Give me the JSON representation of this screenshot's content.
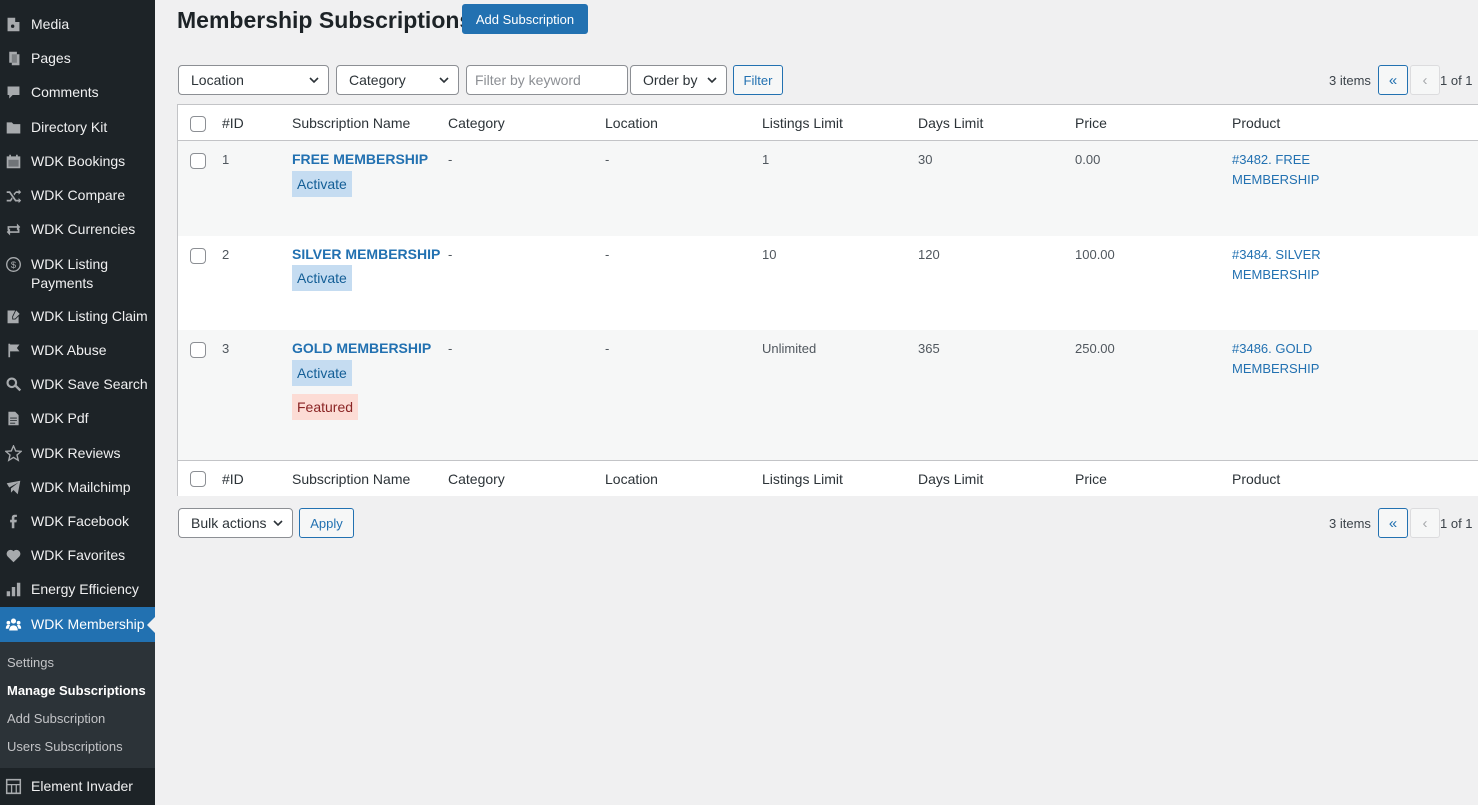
{
  "sidebar": {
    "items": [
      {
        "label": "Media",
        "icon": "media-icon"
      },
      {
        "label": "Pages",
        "icon": "pages-icon"
      },
      {
        "label": "Comments",
        "icon": "comments-icon"
      },
      {
        "label": "Directory Kit",
        "icon": "folder-icon"
      },
      {
        "label": "WDK Bookings",
        "icon": "calendar-icon"
      },
      {
        "label": "WDK Compare",
        "icon": "shuffle-icon"
      },
      {
        "label": "WDK Currencies",
        "icon": "exchange-icon"
      },
      {
        "label": "WDK Listing Payments",
        "icon": "dollar-icon"
      },
      {
        "label": "WDK Listing Claim",
        "icon": "edit-page-icon"
      },
      {
        "label": "WDK Abuse",
        "icon": "flag-icon"
      },
      {
        "label": "WDK Save Search",
        "icon": "search-icon"
      },
      {
        "label": "WDK Pdf",
        "icon": "document-icon"
      },
      {
        "label": "WDK Reviews",
        "icon": "star-icon"
      },
      {
        "label": "WDK Mailchimp",
        "icon": "email-icon"
      },
      {
        "label": "WDK Facebook",
        "icon": "facebook-icon"
      },
      {
        "label": "WDK Favorites",
        "icon": "heart-icon"
      },
      {
        "label": "Energy Efficiency",
        "icon": "bar-chart-icon"
      },
      {
        "label": "WDK Membership",
        "icon": "groups-icon"
      },
      {
        "label": "Element Invader",
        "icon": "grid-icon"
      }
    ],
    "submenu": [
      "Settings",
      "Manage Subscriptions",
      "Add Subscription",
      "Users Subscriptions"
    ]
  },
  "header": {
    "title": "Membership Subscriptions",
    "add_button": "Add Subscription"
  },
  "filters": {
    "location": "Location",
    "category": "Category",
    "keyword_placeholder": "Filter by keyword",
    "order_by": "Order by",
    "filter_button": "Filter"
  },
  "pagination": {
    "items": "3 items",
    "first": "«",
    "prev": "‹",
    "page_of": "1 of 1"
  },
  "table": {
    "columns": [
      "#ID",
      "Subscription Name",
      "Category",
      "Location",
      "Listings Limit",
      "Days Limit",
      "Price",
      "Product"
    ],
    "rows": [
      {
        "id": "1",
        "name": "FREE MEMBERSHIP",
        "badges": [
          "Activate"
        ],
        "category": "-",
        "location": "-",
        "listings_limit": "1",
        "days_limit": "30",
        "price": "0.00",
        "product": "#3482. FREE MEMBERSHIP"
      },
      {
        "id": "2",
        "name": "SILVER MEMBERSHIP",
        "badges": [
          "Activate"
        ],
        "category": "-",
        "location": "-",
        "listings_limit": "10",
        "days_limit": "120",
        "price": "100.00",
        "product": "#3484. SILVER MEMBERSHIP"
      },
      {
        "id": "3",
        "name": "GOLD MEMBERSHIP",
        "badges": [
          "Activate",
          "Featured"
        ],
        "category": "-",
        "location": "-",
        "listings_limit": "Unlimited",
        "days_limit": "365",
        "price": "250.00",
        "product": "#3486. GOLD MEMBERSHIP"
      }
    ]
  },
  "bulk": {
    "actions": "Bulk actions",
    "apply": "Apply"
  }
}
